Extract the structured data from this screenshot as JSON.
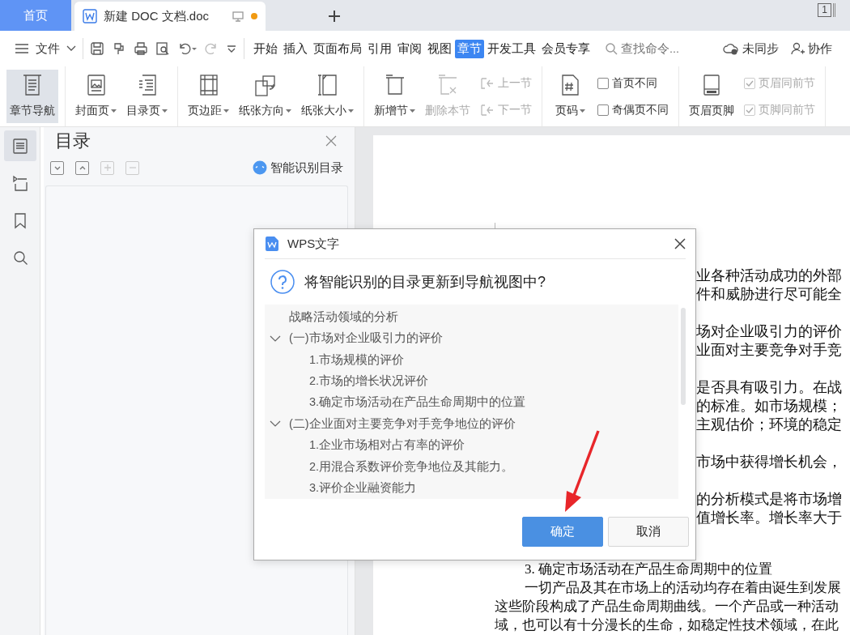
{
  "tabbar": {
    "tabs": [
      {
        "label": "首页",
        "kind": "home",
        "selected": false
      },
      {
        "label": "新建 DOC 文档.doc",
        "kind": "document",
        "selected": true,
        "modified": true
      }
    ],
    "window_count": "1"
  },
  "menubar": {
    "file_menu": "文件",
    "menu_tabs": [
      {
        "label": "开始",
        "selected": false
      },
      {
        "label": "插入",
        "selected": false
      },
      {
        "label": "页面布局",
        "selected": false
      },
      {
        "label": "引用",
        "selected": false
      },
      {
        "label": "审阅",
        "selected": false
      },
      {
        "label": "视图",
        "selected": false
      },
      {
        "label": "章节",
        "selected": true
      },
      {
        "label": "开发工具",
        "selected": false
      },
      {
        "label": "会员专享",
        "selected": false
      }
    ],
    "search": {
      "placeholder": "查找命令..."
    },
    "sync_status": "未同步",
    "collaborate": "协作"
  },
  "ribbon": {
    "groups": [
      [
        {
          "kind": "large",
          "label": "章节导航",
          "selected": true,
          "dropdown": false,
          "disabled": false
        }
      ],
      [
        {
          "kind": "large",
          "label": "封面页",
          "selected": false,
          "dropdown": true,
          "disabled": false
        },
        {
          "kind": "large",
          "label": "目录页",
          "selected": false,
          "dropdown": true,
          "disabled": false
        }
      ],
      [
        {
          "kind": "large",
          "label": "页边距",
          "selected": false,
          "dropdown": true,
          "disabled": false
        },
        {
          "kind": "large",
          "label": "纸张方向",
          "selected": false,
          "dropdown": true,
          "disabled": false
        },
        {
          "kind": "large",
          "label": "纸张大小",
          "selected": false,
          "dropdown": true,
          "disabled": false
        }
      ],
      [
        {
          "kind": "large",
          "label": "新增节",
          "selected": false,
          "dropdown": true,
          "disabled": false
        },
        {
          "kind": "large",
          "label": "删除本节",
          "selected": false,
          "dropdown": false,
          "disabled": true
        },
        {
          "kind": "stack",
          "rows": [
            {
              "kind": "button",
              "label": "上一节",
              "disabled": true
            },
            {
              "kind": "button",
              "label": "下一节",
              "disabled": true
            }
          ]
        }
      ],
      [
        {
          "kind": "large",
          "label": "页码",
          "selected": false,
          "dropdown": true,
          "disabled": false
        },
        {
          "kind": "stack",
          "rows": [
            {
              "kind": "checkbox",
              "label": "首页不同",
              "checked": false,
              "disabled": false
            },
            {
              "kind": "checkbox",
              "label": "奇偶页不同",
              "checked": false,
              "disabled": false
            }
          ]
        }
      ],
      [
        {
          "kind": "large",
          "label": "页眉页脚",
          "selected": false,
          "dropdown": false,
          "disabled": false
        },
        {
          "kind": "stack",
          "rows": [
            {
              "kind": "checkbox",
              "label": "页眉同前节",
              "checked": true,
              "disabled": true
            },
            {
              "kind": "checkbox",
              "label": "页脚同前节",
              "checked": true,
              "disabled": true
            }
          ]
        }
      ]
    ]
  },
  "sidebar": {
    "items": [
      {
        "selected": true
      },
      {
        "selected": false
      },
      {
        "selected": false
      },
      {
        "selected": false
      }
    ]
  },
  "nav_panel": {
    "title": "目录",
    "tools": [
      {
        "disabled": false
      },
      {
        "disabled": false
      },
      {
        "disabled": true
      },
      {
        "disabled": true
      }
    ],
    "smart_button": "智能识别目录"
  },
  "document": {
    "right_paragraphs": [
      [
        "业各种活动成功的外部",
        "件和威胁进行尽可能全"
      ],
      [
        "场对企业吸引力的评价",
        "业面对主要竞争对手竞"
      ],
      [
        "是否具有吸引力。在战",
        "的标准。如市场规模；",
        "主观估价；环境的稳定"
      ],
      [
        "市场中获得增长机会，"
      ],
      [
        "的分析模式是将市场增",
        "值增长率。增长率大于"
      ]
    ],
    "lower_lines": [
      {
        "text": "3. 确定市场活动在产品生命周期中的位置",
        "indent": true
      },
      {
        "text": "一切产品及其在市场上的活动均存在着由诞生到发展",
        "indent": true
      },
      {
        "text": "这些阶段构成了产品生命周期曲线。一个产品或一种活动",
        "indent": false
      },
      {
        "text": "域，也可以有十分漫长的生命，如稳定性技术领域，在此",
        "indent": false
      }
    ]
  },
  "dialog": {
    "title": "WPS文字",
    "question": "将智能识别的目录更新到导航视图中?",
    "toc": [
      {
        "label": "战略活动领域的分析"
      },
      {
        "label": "(一)市场对企业吸引力的评价",
        "expanded": true,
        "children": [
          {
            "label": "1.市场规模的评价"
          },
          {
            "label": "2.市场的增长状况评价"
          },
          {
            "label": "3.确定市场活动在产品生命周期中的位置"
          }
        ]
      },
      {
        "label": "(二)企业面对主要竞争对手竞争地位的评价",
        "expanded": true,
        "children": [
          {
            "label": "1.企业市场相对占有率的评价"
          },
          {
            "label": "2.用混合系数评价竞争地位及其能力。"
          },
          {
            "label": "3.评价企业融资能力"
          }
        ]
      }
    ],
    "buttons": [
      {
        "label": "确定",
        "kind": "primary"
      },
      {
        "label": "取消",
        "kind": "secondary"
      }
    ]
  }
}
